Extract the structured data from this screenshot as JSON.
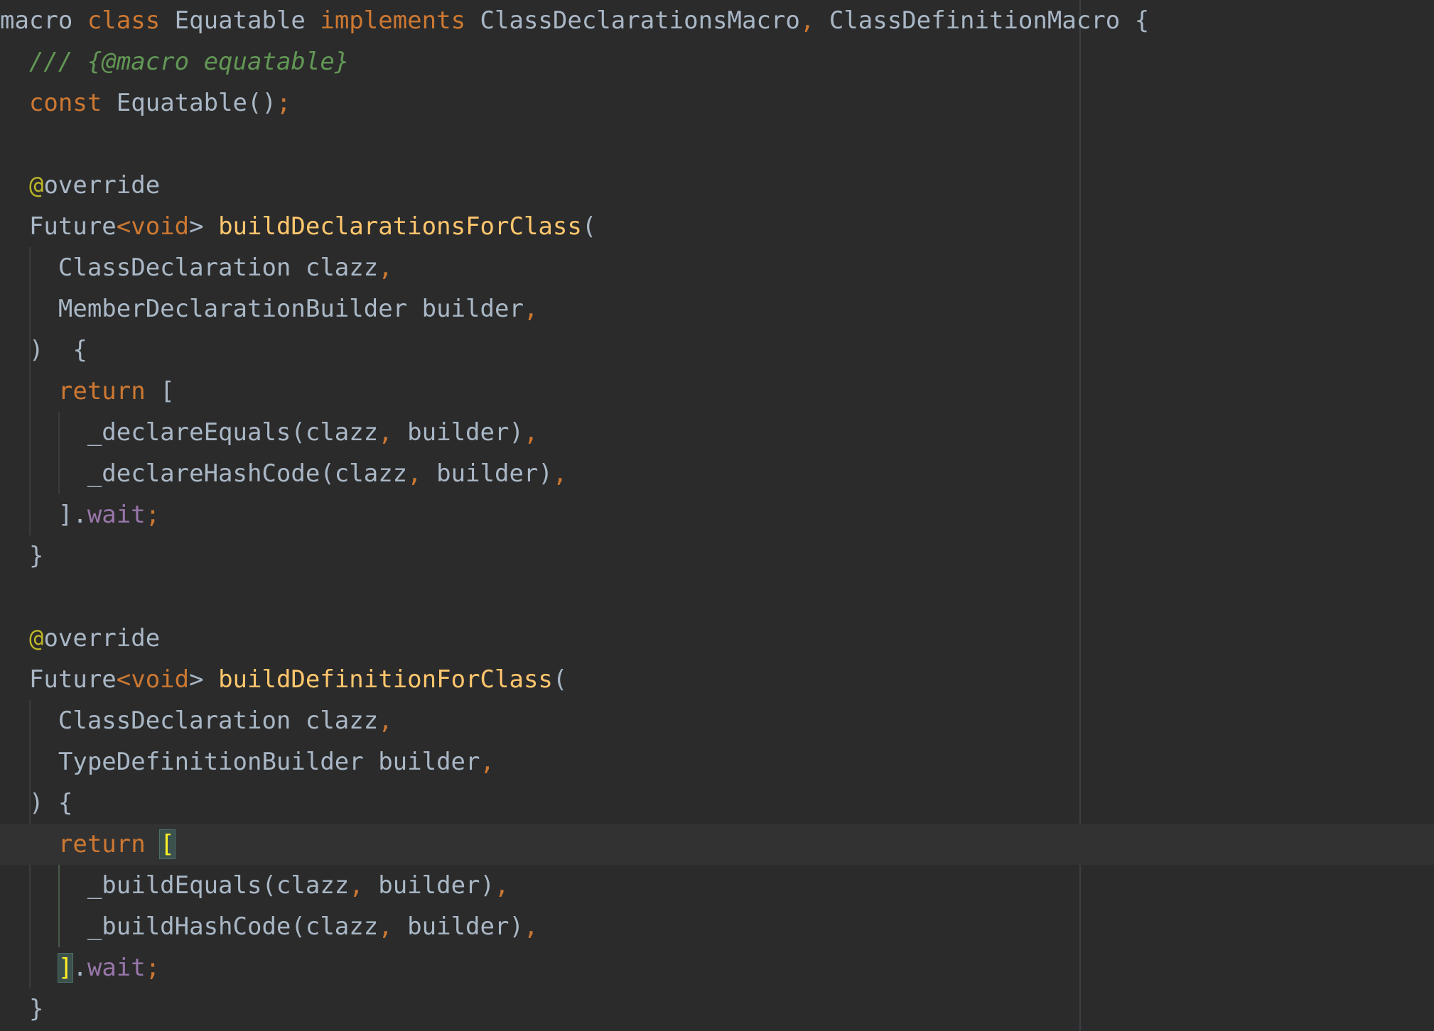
{
  "editor": {
    "current_line_index": 20,
    "lines": [
      [
        [
          "kw",
          ""
        ],
        [
          "id",
          "macro "
        ],
        [
          "kw",
          "class "
        ],
        [
          "id",
          "Equatable "
        ],
        [
          "kw",
          "implements "
        ],
        [
          "id",
          "ClassDeclarationsMacro"
        ],
        [
          "pn",
          ", "
        ],
        [
          "id",
          "ClassDefinitionMacro {"
        ]
      ],
      [
        [
          "id",
          "  "
        ],
        [
          "cm",
          "/// {@macro equatable}"
        ]
      ],
      [
        [
          "id",
          "  "
        ],
        [
          "kw",
          "const "
        ],
        [
          "id",
          "Equatable()"
        ],
        [
          "pn",
          ";"
        ]
      ],
      [
        [
          "id",
          ""
        ]
      ],
      [
        [
          "id",
          "  "
        ],
        [
          "an",
          "@"
        ],
        [
          "id",
          "override"
        ]
      ],
      [
        [
          "id",
          "  Future"
        ],
        [
          "kw",
          "<void"
        ],
        [
          "id",
          "> "
        ],
        [
          "fn",
          "buildDeclarationsForClass"
        ],
        [
          "id",
          "("
        ]
      ],
      [
        [
          "id",
          "    ClassDeclaration clazz"
        ],
        [
          "pn",
          ","
        ]
      ],
      [
        [
          "id",
          "    MemberDeclarationBuilder builder"
        ],
        [
          "pn",
          ","
        ]
      ],
      [
        [
          "id",
          "  )  {"
        ]
      ],
      [
        [
          "id",
          "    "
        ],
        [
          "kw",
          "return "
        ],
        [
          "id",
          "["
        ]
      ],
      [
        [
          "id",
          "      _declareEquals(clazz"
        ],
        [
          "pn",
          ", "
        ],
        [
          "id",
          "builder)"
        ],
        [
          "pn",
          ","
        ]
      ],
      [
        [
          "id",
          "      _declareHashCode(clazz"
        ],
        [
          "pn",
          ", "
        ],
        [
          "id",
          "builder)"
        ],
        [
          "pn",
          ","
        ]
      ],
      [
        [
          "id",
          "    ]."
        ],
        [
          "pr",
          "wait"
        ],
        [
          "pn",
          ";"
        ]
      ],
      [
        [
          "id",
          "  }"
        ]
      ],
      [
        [
          "id",
          ""
        ]
      ],
      [
        [
          "id",
          "  "
        ],
        [
          "an",
          "@"
        ],
        [
          "id",
          "override"
        ]
      ],
      [
        [
          "id",
          "  Future"
        ],
        [
          "kw",
          "<void"
        ],
        [
          "id",
          "> "
        ],
        [
          "fn",
          "buildDefinitionForClass"
        ],
        [
          "id",
          "("
        ]
      ],
      [
        [
          "id",
          "    ClassDeclaration clazz"
        ],
        [
          "pn",
          ","
        ]
      ],
      [
        [
          "id",
          "    TypeDefinitionBuilder builder"
        ],
        [
          "pn",
          ","
        ]
      ],
      [
        [
          "id",
          "  ) {"
        ]
      ],
      [
        [
          "id",
          "    "
        ],
        [
          "kw",
          "return "
        ],
        [
          "bm",
          "["
        ]
      ],
      [
        [
          "id",
          "      _buildEquals(clazz"
        ],
        [
          "pn",
          ", "
        ],
        [
          "id",
          "builder)"
        ],
        [
          "pn",
          ","
        ]
      ],
      [
        [
          "id",
          "      _buildHashCode(clazz"
        ],
        [
          "pn",
          ", "
        ],
        [
          "id",
          "builder)"
        ],
        [
          "pn",
          ","
        ]
      ],
      [
        [
          "id",
          "    "
        ],
        [
          "bm",
          "]"
        ],
        [
          "id",
          "."
        ],
        [
          "pr",
          "wait"
        ],
        [
          "pn",
          ";"
        ]
      ],
      [
        [
          "id",
          "  }"
        ]
      ]
    ]
  },
  "colors": {
    "background": "#2b2b2b",
    "keyword": "#cc7832",
    "function": "#ffc66d",
    "comment": "#629755",
    "annotation": "#bbb529",
    "property": "#9876aa",
    "identifier": "#a9b7c6",
    "brace_match": "#ffef28"
  }
}
